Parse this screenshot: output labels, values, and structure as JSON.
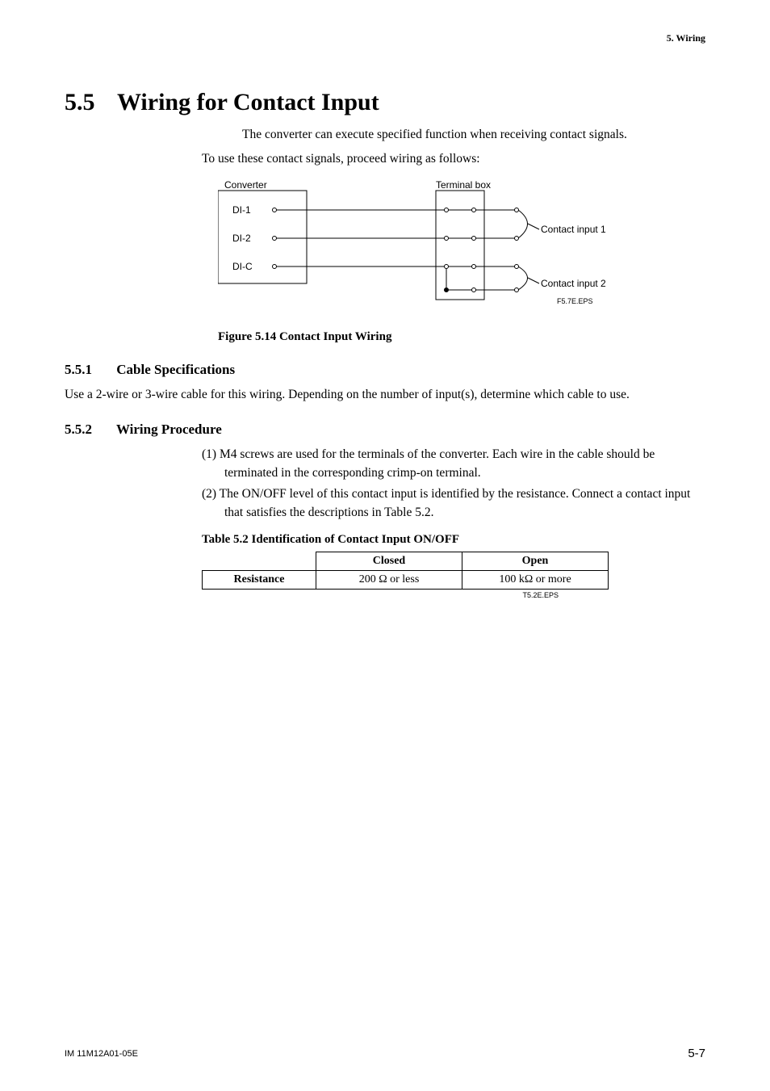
{
  "header": {
    "chapter_label": "5.  Wiring"
  },
  "section": {
    "number": "5.5",
    "title": "Wiring for Contact Input",
    "intro_line_indent": "The converter can execute specified function when receiving contact signals.",
    "intro_line": "To use these contact signals, proceed wiring as follows:"
  },
  "figure": {
    "converter_label": "Converter",
    "terminal_box_label": "Terminal box",
    "di1": "DI-1",
    "di2": "DI-2",
    "dic": "DI-C",
    "contact1": "Contact input 1",
    "contact2": "Contact input 2",
    "eps": "F5.7E.EPS",
    "caption": "Figure 5.14 Contact Input Wiring"
  },
  "sub1": {
    "number": "5.5.1",
    "title": "Cable Specifications",
    "para": "Use a 2-wire or 3-wire cable for this wiring. Depending on the number of input(s), determine which cable to use."
  },
  "sub2": {
    "number": "5.5.2",
    "title": "Wiring Procedure",
    "item1": "(1) M4 screws are used for the terminals of the converter. Each wire in the cable should be terminated in the corresponding crimp-on  terminal.",
    "item2": "(2) The ON/OFF level of this contact input is identified by the resistance. Connect a contact input that satisfies the descriptions in Table 5.2."
  },
  "table": {
    "caption": "Table 5.2   Identification of Contact Input ON/OFF",
    "col_closed": "Closed",
    "col_open": "Open",
    "row_label": "Resistance",
    "closed_val": "200 Ω or less",
    "open_val": "100 kΩ or more",
    "eps": "T5.2E.EPS"
  },
  "chart_data": {
    "type": "table",
    "title": "Identification of Contact Input ON/OFF",
    "columns": [
      "",
      "Closed",
      "Open"
    ],
    "rows": [
      {
        "label": "Resistance",
        "Closed": "200 Ω or less",
        "Open": "100 kΩ or more"
      }
    ]
  },
  "footer": {
    "left": "IM 11M12A01-05E",
    "right": "5-7"
  }
}
